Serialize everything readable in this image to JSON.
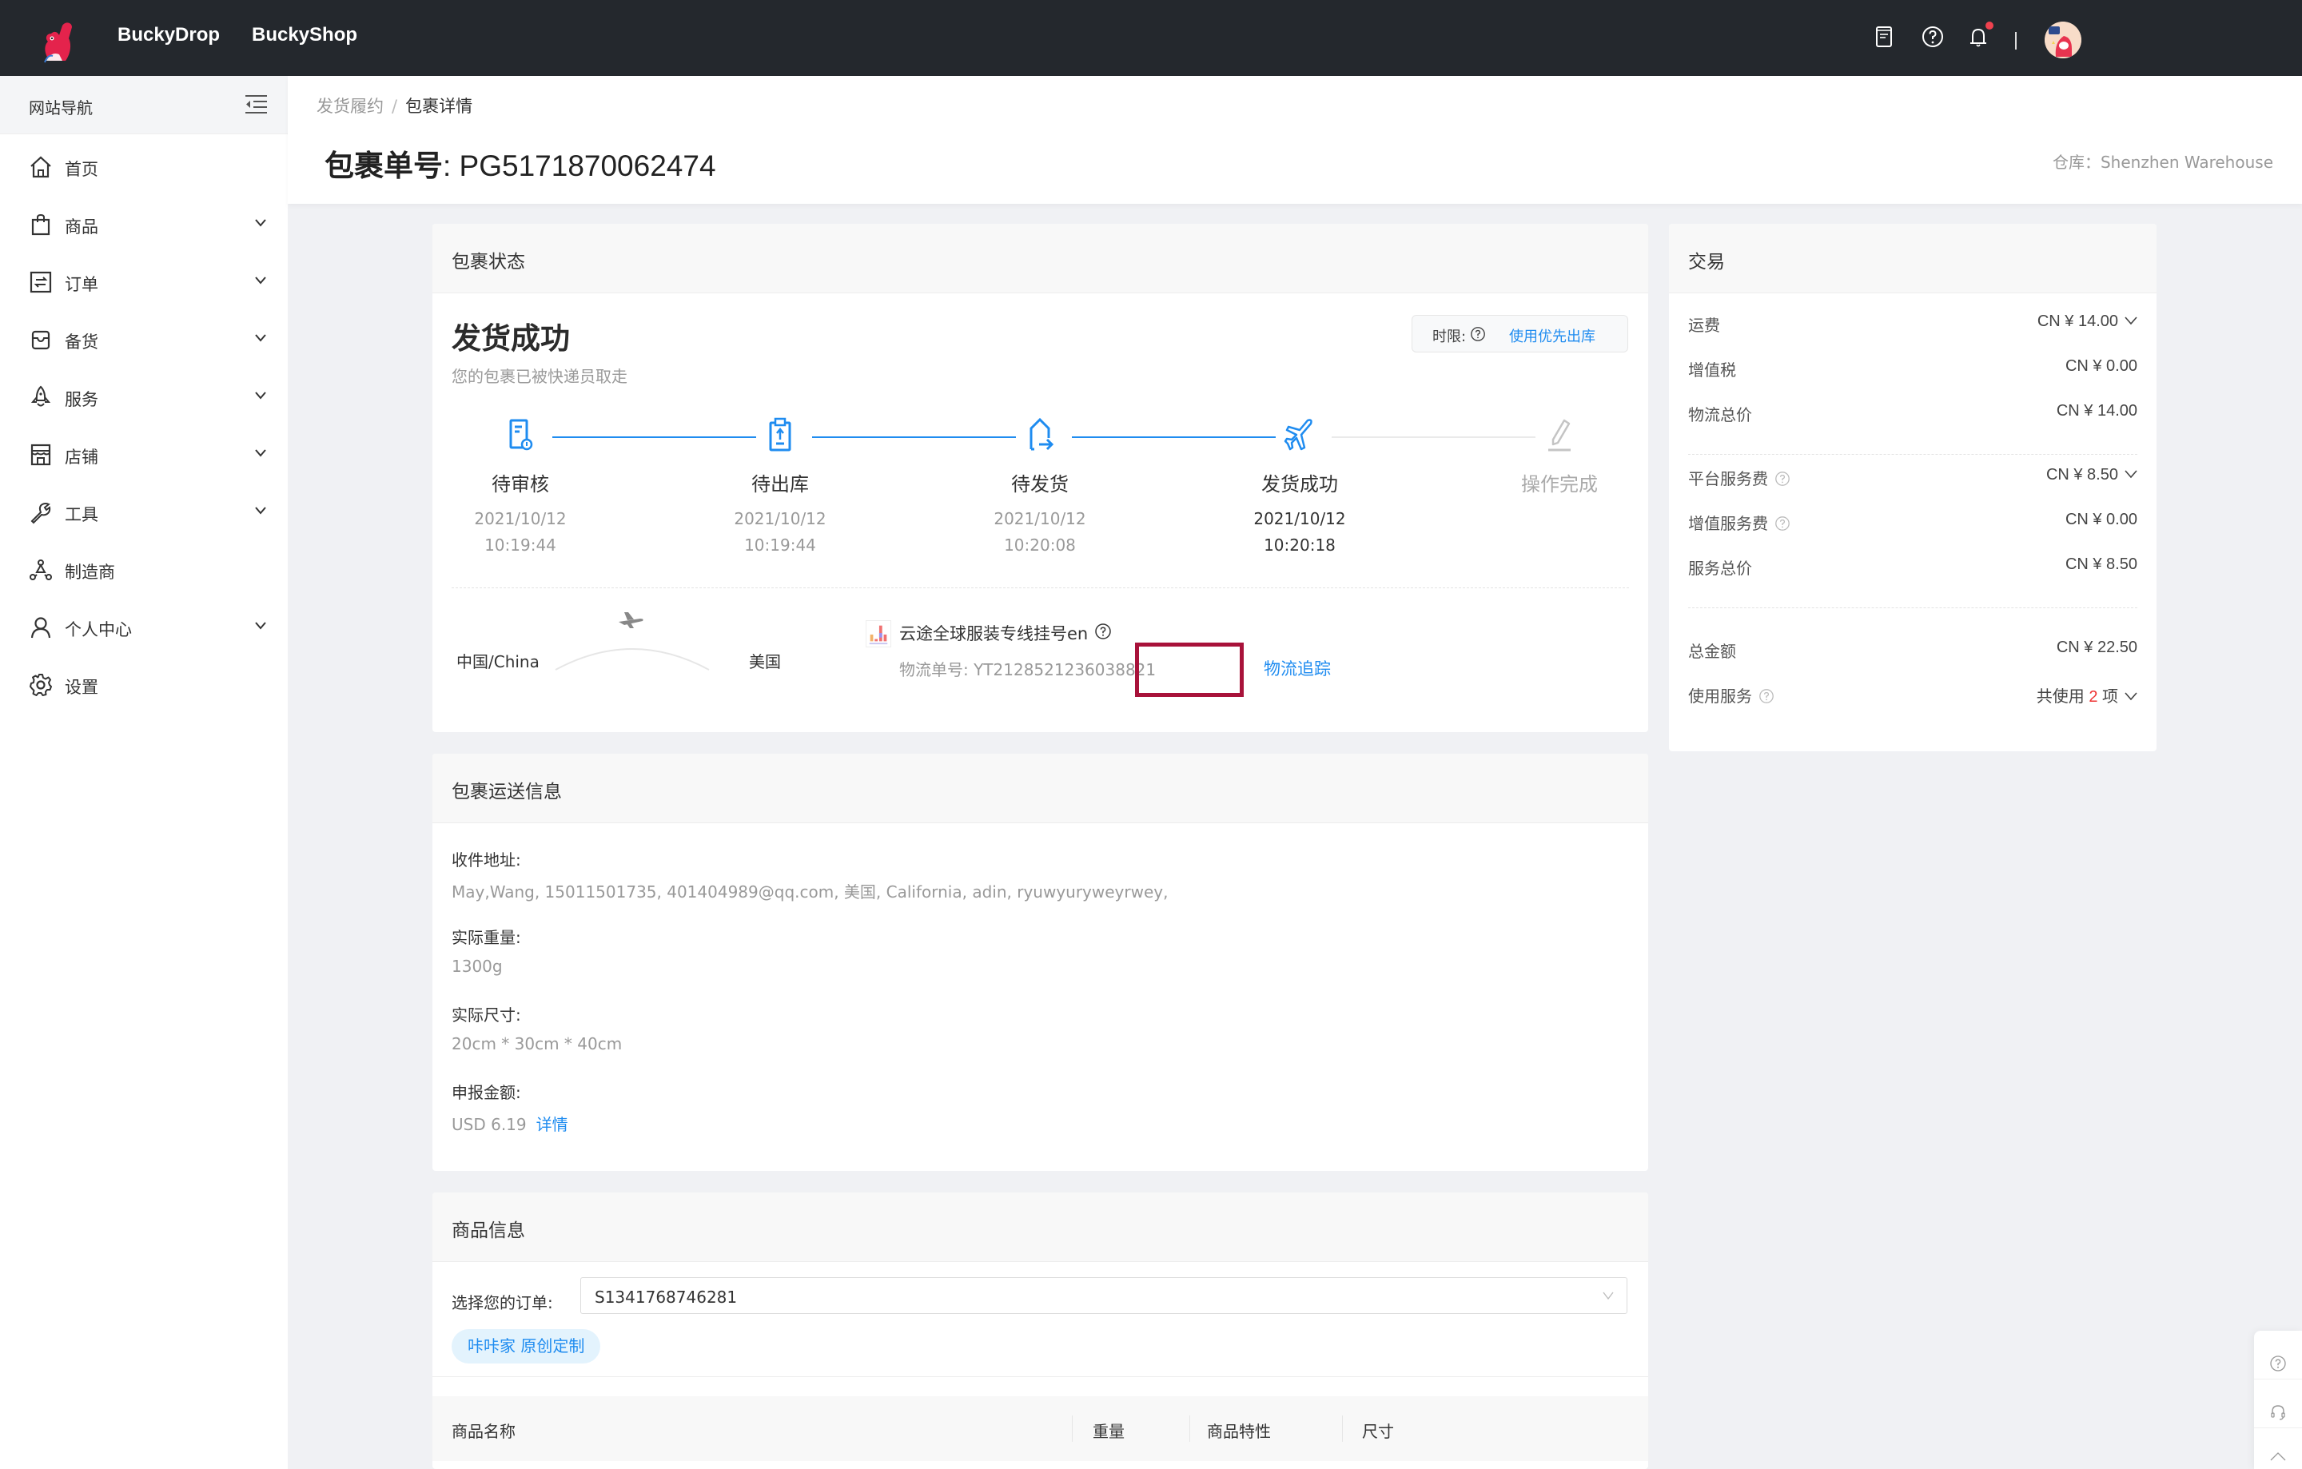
{
  "header": {
    "brands": [
      "BuckyDrop",
      "BuckyShop"
    ],
    "icons": [
      "docs-icon",
      "help-icon",
      "bell-icon"
    ],
    "has_notification": true
  },
  "sidebar": {
    "title": "网站导航",
    "items": [
      {
        "label": "首页",
        "icon": "home-icon",
        "expandable": false
      },
      {
        "label": "商品",
        "icon": "bag-icon",
        "expandable": true
      },
      {
        "label": "订单",
        "icon": "order-icon",
        "expandable": true
      },
      {
        "label": "备货",
        "icon": "inbox-icon",
        "expandable": true
      },
      {
        "label": "服务",
        "icon": "rocket-icon",
        "expandable": true
      },
      {
        "label": "店铺",
        "icon": "store-icon",
        "expandable": true
      },
      {
        "label": "工具",
        "icon": "wrench-icon",
        "expandable": true
      },
      {
        "label": "制造商",
        "icon": "network-icon",
        "expandable": false
      },
      {
        "label": "个人中心",
        "icon": "user-icon",
        "expandable": true
      },
      {
        "label": "设置",
        "icon": "gear-icon",
        "expandable": false
      }
    ]
  },
  "breadcrumb": {
    "parent": "发货履约",
    "separator": "/",
    "current": "包裹详情"
  },
  "page": {
    "title_label": "包裹单号",
    "title_value": ": PG5171870062474",
    "warehouse": "仓库：Shenzhen Warehouse"
  },
  "status_panel": {
    "title": "包裹状态",
    "status": "发货成功",
    "status_desc": "您的包裹已被快递员取走",
    "time_limit_label": "时限:",
    "priority_link": "使用优先出库",
    "steps": [
      {
        "name": "待审核",
        "date": "2021/10/12",
        "time": "10:19:44",
        "state": "done"
      },
      {
        "name": "待出库",
        "date": "2021/10/12",
        "time": "10:19:44",
        "state": "done"
      },
      {
        "name": "待发货",
        "date": "2021/10/12",
        "time": "10:20:08",
        "state": "done"
      },
      {
        "name": "发货成功",
        "date": "2021/10/12",
        "time": "10:20:18",
        "state": "active"
      },
      {
        "name": "操作完成",
        "date": "",
        "time": "",
        "state": "pending"
      }
    ],
    "route": {
      "from": "中国/China",
      "to": "美国"
    },
    "method": {
      "name": "云途全球服装专线挂号en",
      "tracking_label": "物流单号: YT2128521236038821",
      "tracking_link": "物流追踪"
    }
  },
  "trade_panel": {
    "title": "交易",
    "rows_group1": [
      {
        "label": "运费",
        "value": "CN ¥ 14.00",
        "dropdown": true,
        "help": false
      },
      {
        "label": "增值税",
        "value": "CN ¥ 0.00",
        "dropdown": false,
        "help": false
      },
      {
        "label": "物流总价",
        "value": "CN ¥ 14.00",
        "dropdown": false,
        "help": false
      }
    ],
    "rows_group2": [
      {
        "label": "平台服务费",
        "value": "CN ¥ 8.50",
        "dropdown": true,
        "help": true
      },
      {
        "label": "增值服务费",
        "value": "CN ¥ 0.00",
        "dropdown": false,
        "help": true
      },
      {
        "label": "服务总价",
        "value": "CN ¥ 8.50",
        "dropdown": false,
        "help": false
      }
    ],
    "total": {
      "label": "总金额",
      "value": "CN ¥ 22.50"
    },
    "services": {
      "label": "使用服务",
      "prefix": "共使用",
      "count": "2",
      "suffix": "项"
    }
  },
  "shipping_panel": {
    "title": "包裹运送信息",
    "fields": [
      {
        "label": "收件地址:",
        "value": "May,Wang, 15011501735, 401404989@qq.com, 美国, California, adin, ryuwyuryweyrwey,"
      },
      {
        "label": "实际重量:",
        "value": "1300g"
      },
      {
        "label": "实际尺寸:",
        "value": "20cm * 30cm * 40cm"
      },
      {
        "label": "申报金额:",
        "value": "USD 6.19",
        "link": "详情"
      }
    ]
  },
  "product_panel": {
    "title": "商品信息",
    "order_label": "选择您的订单:",
    "order_value": "S1341768746281",
    "shop_tag": "咔咔家 原创定制",
    "columns": [
      "商品名称",
      "重量",
      "商品特性",
      "尺寸"
    ]
  },
  "float_widgets": [
    "help-icon",
    "headset-icon",
    "back-to-top-icon"
  ],
  "colors": {
    "accent": "#1f8cf0",
    "header_bg": "#24282d",
    "highlight": "#a8123a",
    "alert_red": "#e33333"
  }
}
